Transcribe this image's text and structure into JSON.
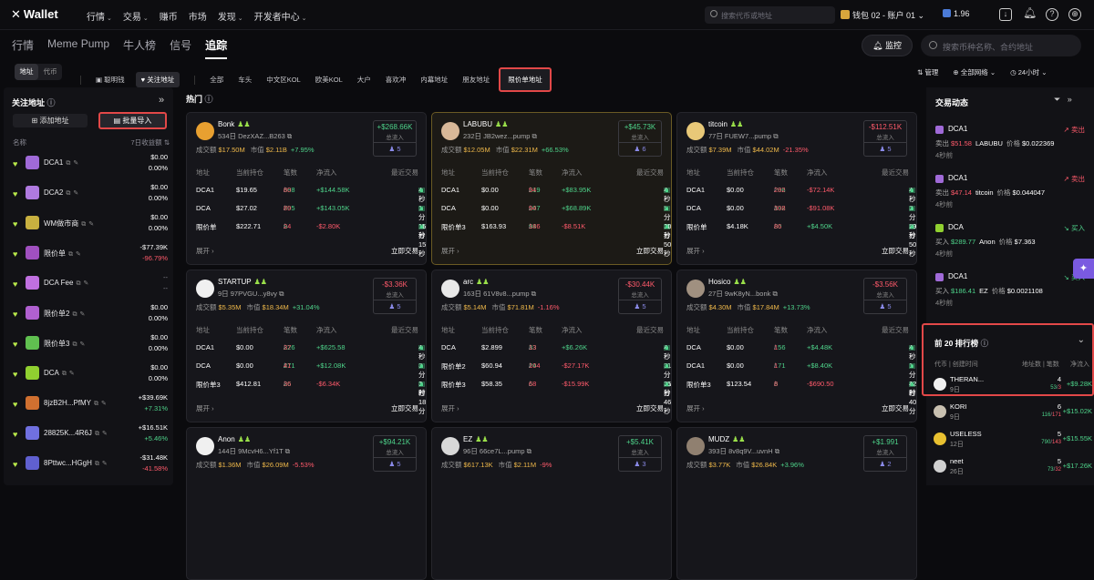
{
  "app": {
    "logo": "Wallet",
    "logo_icon": "x-logo-icon"
  },
  "topnav": [
    {
      "label": "行情",
      "chev": true
    },
    {
      "label": "交易",
      "chev": true
    },
    {
      "label": "赚币",
      "chev": false
    },
    {
      "label": "市场",
      "chev": false
    },
    {
      "label": "发现",
      "chev": true
    },
    {
      "label": "开发者中心",
      "chev": true
    }
  ],
  "top_search": {
    "placeholder": "搜索代币或地址"
  },
  "wallet_account": "钱包 02 - 账户 01",
  "balance": "1.96",
  "main_tabs": [
    "行情",
    "Meme Pump",
    "牛人榜",
    "信号",
    "追踪"
  ],
  "active_main_tab": 4,
  "monitor_label": "监控",
  "main_search": {
    "placeholder": "搜索币种名称、合约地址"
  },
  "segment": [
    "地址",
    "代币"
  ],
  "filter": {
    "smart_money": "聪明钱",
    "watched": "关注地址"
  },
  "filter_tags": [
    "全部",
    "车头",
    "中文区KOL",
    "欧美KOL",
    "大户",
    "喜欢冲",
    "内幕地址",
    "朋友地址"
  ],
  "limit_tab": "限价单地址",
  "right_controls": {
    "manage": "管理",
    "network": "全部网络",
    "time": "24小时"
  },
  "left": {
    "title": "关注地址",
    "add": "添加地址",
    "import": "批量导入",
    "col_name": "名称",
    "col_pnl": "7日收益额",
    "rows": [
      {
        "name": "DCA1",
        "v1": "$0.00",
        "v2": "0.00%",
        "c1": "wh",
        "c2": "wh",
        "color": "#a06ad8"
      },
      {
        "name": "DCA2",
        "v1": "$0.00",
        "v2": "0.00%",
        "c1": "wh",
        "c2": "wh",
        "color": "#b07ae0"
      },
      {
        "name": "WM做市商",
        "v1": "$0.00",
        "v2": "0.00%",
        "c1": "wh",
        "c2": "wh",
        "color": "#c8b040"
      },
      {
        "name": "限价单",
        "v1": "-$77.39K",
        "v2": "-96.79%",
        "c1": "wh",
        "c2": "rd",
        "color": "#a050c0"
      },
      {
        "name": "DCA Fee",
        "v1": "--",
        "v2": "--",
        "c1": "gy",
        "c2": "gy",
        "color": "#c070e0"
      },
      {
        "name": "限价单2",
        "v1": "$0.00",
        "v2": "0.00%",
        "c1": "wh",
        "c2": "wh",
        "color": "#b060d0"
      },
      {
        "name": "限价单3",
        "v1": "$0.00",
        "v2": "0.00%",
        "c1": "wh",
        "c2": "wh",
        "color": "#60c050"
      },
      {
        "name": "DCA",
        "v1": "$0.00",
        "v2": "0.00%",
        "c1": "wh",
        "c2": "wh",
        "color": "#90d030"
      },
      {
        "name": "8jzB2H...PfMY",
        "v1": "+$39.69K",
        "v2": "+7.31%",
        "c1": "wh",
        "c2": "gr",
        "color": "#d07030"
      },
      {
        "name": "28825K...4R6J",
        "v1": "+$16.51K",
        "v2": "+5.46%",
        "c1": "wh",
        "c2": "gr",
        "color": "#7070e0"
      },
      {
        "name": "8Pttwc...HGgH",
        "v1": "-$31.48K",
        "v2": "-41.58%",
        "c1": "wh",
        "c2": "rd",
        "color": "#6060d0"
      }
    ]
  },
  "hot_title": "热门",
  "labels": {
    "mcap": "成交额",
    "mv": "市值",
    "net": "总流入",
    "th": [
      "地址",
      "当前持仓",
      "笔数",
      "净流入",
      "最近交易"
    ],
    "expand": "展开",
    "trade": "立即交易"
  },
  "cards": [
    {
      "name": "Bonk",
      "addr": "534日 DezXAZ...B263",
      "vol": "$17.50M",
      "mv": "$2.11B",
      "chg": "+7.95%",
      "chgc": "gr",
      "net": "+$268.66K",
      "netc": "gr",
      "cnt": "5",
      "color": "#e8a030",
      "hl": false,
      "rows": [
        [
          "DCA1",
          "$19.65",
          "688",
          "80",
          "+$144.58K",
          "gr",
          "4秒"
        ],
        [
          "DCA",
          "$27.02",
          "705",
          "89",
          "+$143.05K",
          "gr",
          "1分11秒"
        ],
        [
          "限价单",
          "$222.71",
          "9",
          "24",
          "-$2.80K",
          "rd",
          "15分15秒"
        ]
      ]
    },
    {
      "name": "LABUBU",
      "addr": "232日 JB2wez...pump",
      "vol": "$12.05M",
      "mv": "$22.31M",
      "chg": "+66.53%",
      "chgc": "gr",
      "net": "+$45.73K",
      "netc": "gr",
      "cnt": "6",
      "color": "#d8b898",
      "hl": true,
      "rows": [
        [
          "DCA1",
          "$0.00",
          "219",
          "94",
          "+$83.95K",
          "gr",
          "4秒"
        ],
        [
          "DCA",
          "$0.00",
          "207",
          "94",
          "+$68.89K",
          "gr",
          "5分11秒"
        ],
        [
          "限价单3",
          "$163.93",
          "94",
          "186",
          "-$8.51K",
          "rd",
          "30分50秒"
        ]
      ]
    },
    {
      "name": "titcoin",
      "addr": "77日 FUEW7...pump",
      "vol": "$7.39M",
      "mv": "$44.02M",
      "chg": "-21.35%",
      "chgc": "rd",
      "net": "-$112.51K",
      "netc": "rd",
      "cnt": "5",
      "color": "#e8c878",
      "hl": false,
      "rows": [
        [
          "DCA1",
          "$0.00",
          "206",
          "282",
          "-$72.14K",
          "rd",
          "4秒"
        ],
        [
          "DCA",
          "$0.00",
          "192",
          "308",
          "-$91.08K",
          "rd",
          "3分59秒"
        ],
        [
          "限价单",
          "$4.18K",
          "80",
          "86",
          "+$4.50K",
          "gr",
          "20分50秒"
        ]
      ]
    },
    {
      "name": "STARTUP",
      "addr": "9日 97PVGU...y8vy",
      "vol": "$5.35M",
      "mv": "$18.34M",
      "chg": "+31.04%",
      "chgc": "gr",
      "net": "-$3.36K",
      "netc": "rd",
      "cnt": "5",
      "color": "#f0f0f0",
      "hl": false,
      "rows": [
        [
          "DCA1",
          "$0.00",
          "226",
          "37",
          "+$625.58",
          "gr",
          "4秒"
        ],
        [
          "DCA",
          "$0.00",
          "271",
          "41",
          "+$12.08K",
          "gr",
          "3分3秒"
        ],
        [
          "限价单3",
          "$412.81",
          "26",
          "36",
          "-$6.34K",
          "rd",
          "1时18分"
        ]
      ]
    },
    {
      "name": "arc",
      "addr": "163日 61V8v8...pump",
      "vol": "$5.14M",
      "mv": "$71.81M",
      "chg": "-1.16%",
      "chgc": "rd",
      "net": "-$30.44K",
      "netc": "rd",
      "cnt": "5",
      "color": "#e8e8e8",
      "hl": false,
      "rows": [
        [
          "DCA",
          "$2.899",
          "33",
          "13",
          "+$6.26K",
          "gr",
          "4秒"
        ],
        [
          "限价单2",
          "$60.94",
          "24",
          "104",
          "-$27.17K",
          "rd",
          "31分35秒"
        ],
        [
          "限价单3",
          "$58.35",
          "6",
          "68",
          "-$15.99K",
          "rd",
          "31分46秒"
        ]
      ]
    },
    {
      "name": "Hosico",
      "addr": "27日 9wK8yN...bonk",
      "vol": "$4.30M",
      "mv": "$17.84M",
      "chg": "+13.73%",
      "chgc": "gr",
      "net": "-$3.56K",
      "netc": "rd",
      "cnt": "5",
      "color": "#a09080",
      "hl": false,
      "rows": [
        [
          "DCA",
          "$0.00",
          "156",
          "1",
          "+$4.48K",
          "gr",
          "4秒"
        ],
        [
          "DCA1",
          "$0.00",
          "171",
          "1",
          "+$8.40K",
          "gr",
          "1分12秒"
        ],
        [
          "限价单3",
          "$123.54",
          "6",
          "8",
          "-$690.50",
          "rd",
          "4时40分"
        ]
      ]
    },
    {
      "name": "Anon",
      "addr": "144日 9McvH6...Yf1T",
      "vol": "$1.36M",
      "mv": "$26.09M",
      "chg": "-5.53%",
      "chgc": "rd",
      "net": "+$94.21K",
      "netc": "gr",
      "cnt": "5",
      "color": "#f0f0f0",
      "hl": false,
      "rows": []
    },
    {
      "name": "EZ",
      "addr": "96日 66ce7L...pump",
      "vol": "$617.13K",
      "mv": "$2.11M",
      "chg": "-9%",
      "chgc": "rd",
      "net": "+$5.41K",
      "netc": "gr",
      "cnt": "3",
      "color": "#d8d8d8",
      "hl": false,
      "rows": []
    },
    {
      "name": "MUDZ",
      "addr": "393日 8v8q9V...uvnH",
      "vol": "$3.77K",
      "mv": "$26.84K",
      "chg": "+3.96%",
      "chgc": "gr",
      "net": "+$1.991",
      "netc": "gr",
      "cnt": "2",
      "color": "#908070",
      "hl": false,
      "rows": []
    }
  ],
  "right": {
    "title": "交易动态",
    "feed": [
      {
        "name": "DCA1",
        "action": "卖出",
        "ac": "rd",
        "amt_label": "卖出",
        "amt": "$51.58",
        "token": "LABUBU",
        "price": "$0.022369",
        "time": "4秒前",
        "color": "#a06ad8"
      },
      {
        "name": "DCA1",
        "action": "卖出",
        "ac": "rd",
        "amt_label": "卖出",
        "amt": "$47.14",
        "token": "titcoin",
        "price": "$0.044047",
        "time": "4秒前",
        "color": "#a06ad8"
      },
      {
        "name": "DCA",
        "action": "买入",
        "ac": "gr",
        "amt_label": "买入",
        "amt": "$289.77",
        "token": "Anon",
        "price": "$7.363",
        "time": "4秒前",
        "color": "#90d030"
      },
      {
        "name": "DCA1",
        "action": "买入",
        "ac": "gr",
        "amt_label": "买入",
        "amt": "$186.41",
        "token": "EZ",
        "price": "$0.0021108",
        "time": "4秒前",
        "color": "#a06ad8"
      }
    ],
    "price_label": "价格"
  },
  "rank": {
    "title": "前 20 排行榜",
    "head": [
      "代币 | 创建时间",
      "地址数 | 笔数",
      "净流入"
    ],
    "rows": [
      {
        "name": "THERAN...",
        "age": "9日",
        "cnt": "4",
        "s1": "53",
        "s2": "3",
        "net": "+$9.28K",
        "color": "#f0f0f0"
      },
      {
        "name": "KORI",
        "age": "9日",
        "cnt": "6",
        "s1": "116",
        "s2": "171",
        "net": "+$15.02K",
        "color": "#c8c0b0"
      },
      {
        "name": "USELESS",
        "age": "12日",
        "cnt": "5",
        "s1": "790",
        "s2": "143",
        "net": "+$15.55K",
        "color": "#e8c030"
      },
      {
        "name": "neet",
        "age": "26日",
        "cnt": "5",
        "s1": "73",
        "s2": "32",
        "net": "+$17.26K",
        "color": "#d0d0d0"
      }
    ]
  }
}
